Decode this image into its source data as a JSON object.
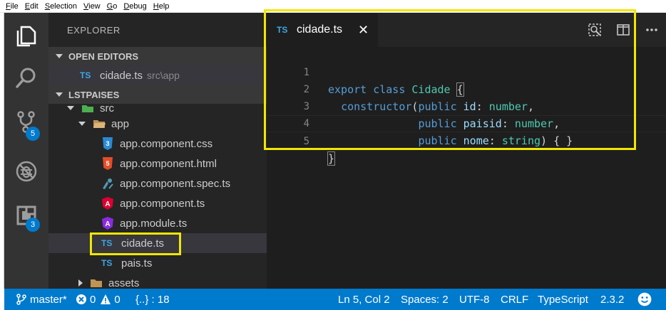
{
  "menu": {
    "items": [
      {
        "underline": "F",
        "rest": "ile"
      },
      {
        "underline": "E",
        "rest": "dit"
      },
      {
        "underline": "S",
        "rest": "election"
      },
      {
        "underline": "V",
        "rest": "iew"
      },
      {
        "underline": "G",
        "rest": "o"
      },
      {
        "underline": "D",
        "rest": "ebug"
      },
      {
        "underline": "H",
        "rest": "elp"
      }
    ]
  },
  "activity": {
    "items": [
      {
        "icon": "files-icon"
      },
      {
        "icon": "search-icon"
      },
      {
        "icon": "source-control-icon",
        "badge": "5"
      },
      {
        "icon": "debug-icon"
      },
      {
        "icon": "extensions-icon",
        "badge": "3"
      }
    ]
  },
  "sidebar": {
    "title": "EXPLORER",
    "open_editors_label": "OPEN EDITORS",
    "open_editor": {
      "badge": "TS",
      "name": "cidade.ts",
      "path": "src\\app"
    },
    "project_label": "LSTPAISES",
    "tree": {
      "src": "src",
      "app": "app",
      "files": [
        {
          "name": "app.component.css",
          "icon": "css-icon"
        },
        {
          "name": "app.component.html",
          "icon": "html-icon"
        },
        {
          "name": "app.component.spec.ts",
          "icon": "spec-test-icon"
        },
        {
          "name": "app.component.ts",
          "icon": "angular-icon"
        },
        {
          "name": "app.module.ts",
          "icon": "angular-module-icon"
        },
        {
          "name": "cidade.ts",
          "icon": "typescript-icon",
          "badge": "TS"
        },
        {
          "name": "pais.ts",
          "icon": "typescript-icon",
          "badge": "TS"
        }
      ],
      "assets": "assets"
    }
  },
  "editor": {
    "tab": {
      "badge": "TS",
      "label": "cidade.ts",
      "close": "✕"
    },
    "line_numbers": [
      "1",
      "2",
      "3",
      "4",
      "5"
    ],
    "code": {
      "l1": {
        "kw1": "export",
        "kw2": "class",
        "cls": "Cidade",
        "brace": "{"
      },
      "l2": {
        "kw": "constructor",
        "p1": "(",
        "kw2": "public",
        "name": "id",
        "colon": ": ",
        "type": "number",
        "end": ","
      },
      "l3": {
        "kw": "public",
        "name": "paisid",
        "colon": ": ",
        "type": "number",
        "end": ","
      },
      "l4": {
        "kw": "public",
        "name": "nome",
        "colon": ": ",
        "type": "string",
        "end": ") { }"
      },
      "l5": {
        "brace": "}"
      }
    }
  },
  "status": {
    "branch": "master*",
    "errors": "0",
    "warnings": "0",
    "scope": "{..} : 18",
    "position": "Ln 5, Col 2",
    "spaces": "Spaces: 2",
    "encoding": "UTF-8",
    "eol": "CRLF",
    "language": "TypeScript",
    "version": "2.3.2"
  },
  "colors": {
    "highlight": "#f2e600",
    "statusbar": "#007acc",
    "activitybar": "#333333",
    "sidebar": "#252526",
    "editor": "#1e1e1e"
  }
}
